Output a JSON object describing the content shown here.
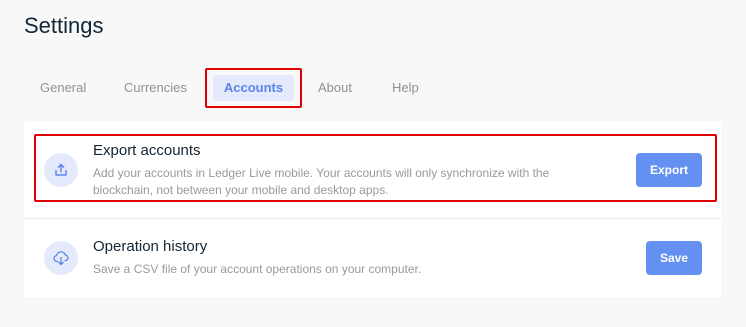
{
  "page": {
    "title": "Settings"
  },
  "tabs": [
    {
      "label": "General",
      "active": false
    },
    {
      "label": "Currencies",
      "active": false
    },
    {
      "label": "Accounts",
      "active": true
    },
    {
      "label": "About",
      "active": false
    },
    {
      "label": "Help",
      "active": false
    }
  ],
  "rows": {
    "export": {
      "icon": "upload-icon",
      "title": "Export accounts",
      "description": "Add your accounts in Ledger Live mobile. Your accounts will only synchronize with the blockchain, not between your mobile and desktop apps.",
      "button_label": "Export"
    },
    "history": {
      "icon": "cloud-download-icon",
      "title": "Operation history",
      "description": "Save a CSV file of your account operations on your computer.",
      "button_label": "Save"
    }
  },
  "colors": {
    "accent": "#6490f1",
    "accent_light": "#e4eafc",
    "highlight_annotation": "#e00000",
    "background": "#f8f8f8"
  }
}
